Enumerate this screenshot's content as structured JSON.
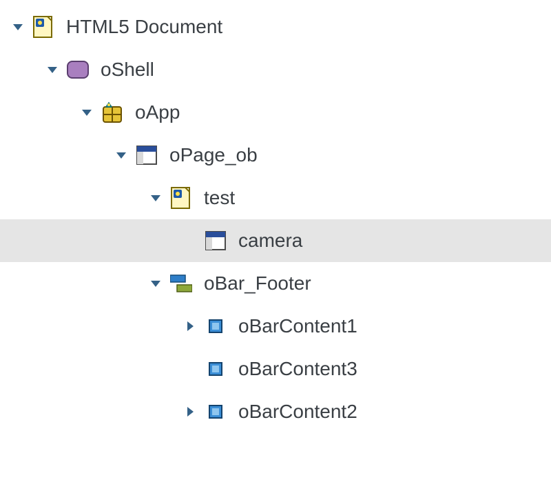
{
  "tree": {
    "root": {
      "label": "HTML5 Document"
    },
    "shell": {
      "label": "oShell"
    },
    "app": {
      "label": "oApp"
    },
    "page": {
      "label": "oPage_ob"
    },
    "test": {
      "label": "test"
    },
    "camera": {
      "label": "camera"
    },
    "footer": {
      "label": "oBar_Footer"
    },
    "bc1": {
      "label": "oBarContent1"
    },
    "bc3": {
      "label": "oBarContent3"
    },
    "bc2": {
      "label": "oBarContent2"
    }
  },
  "colors": {
    "arrow": "#346187",
    "selected_bg": "#e5e5e5"
  }
}
